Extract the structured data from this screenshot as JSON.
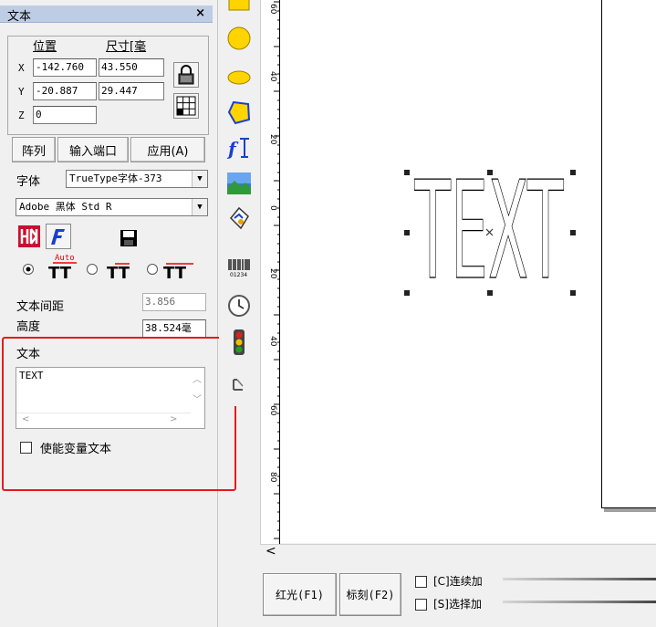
{
  "panel": {
    "title": "文本",
    "close": "×",
    "position_label": "位置",
    "size_label": "尺寸[毫",
    "x_label": "X",
    "y_label": "Y",
    "z_label": "Z",
    "x_pos": "-142.760",
    "x_size": "43.550",
    "y_pos": "-20.887",
    "y_size": "29.447",
    "z_pos": "0",
    "array_button": "阵列",
    "input_port_button": "输入端口",
    "apply_button": "应用(A)",
    "font_label": "字体",
    "font_type": "TrueType字体-373",
    "font_name": "Adobe 黑体 Std R",
    "auto_label": "Auto",
    "char_spacing_label": "文本间距",
    "char_spacing_value": "3.856",
    "height_label": "高度",
    "height_value": "38.524毫",
    "text_label": "文本",
    "text_value": "TEXT",
    "enable_variable_text": "使能变量文本"
  },
  "canvas": {
    "object_text": "TEXT",
    "ruler_labels": [
      "60",
      "40",
      "20",
      "0",
      "20",
      "40",
      "60",
      "80"
    ]
  },
  "bottom": {
    "red_light_button": "红光(F1)",
    "mark_button": "标刻(F2)",
    "continuous_label": "[C]连续加",
    "selection_label": "[S]选择加"
  },
  "colors": {
    "highlight": "#e61b1b",
    "panel_header": "#bfcde4",
    "tool_yellow": "#ffd400"
  }
}
